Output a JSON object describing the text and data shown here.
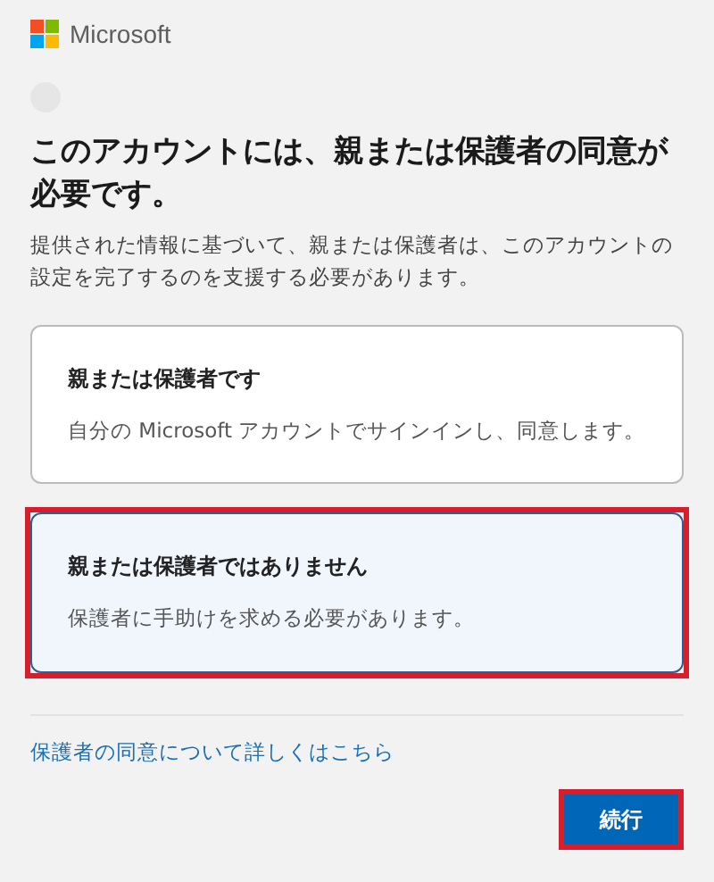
{
  "brand": "Microsoft",
  "heading": "このアカウントには、親または保護者の同意が必要です。",
  "description": "提供された情報に基づいて、親または保護者は、このアカウントの設定を完了するのを支援する必要があります。",
  "options": [
    {
      "title": "親または保護者です",
      "subtitle": "自分の Microsoft アカウントでサインインし、同意します。",
      "selected": false,
      "highlighted": false
    },
    {
      "title": "親または保護者ではありません",
      "subtitle": "保護者に手助けを求める必要があります。",
      "selected": true,
      "highlighted": true
    }
  ],
  "link": "保護者の同意について詳しくはこちら",
  "button": {
    "label": "続行",
    "highlighted": true
  }
}
